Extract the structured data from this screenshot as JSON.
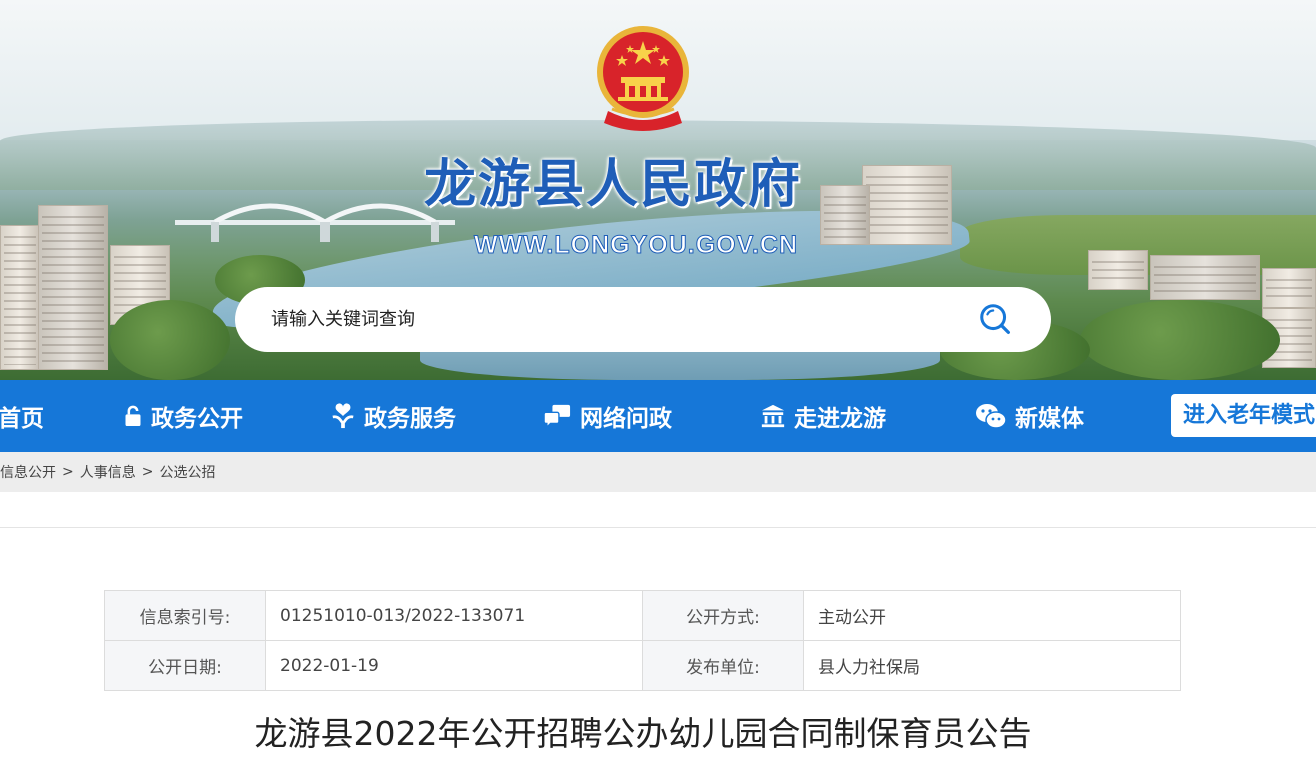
{
  "header": {
    "site_title": "龙游县人民政府",
    "site_url": "WWW.LONGYOU.GOV.CN",
    "emblem_icon": "national-emblem-icon",
    "search": {
      "placeholder": "请输入关键词查询",
      "icon": "search-icon"
    }
  },
  "nav": {
    "items": [
      {
        "label": "首页",
        "icon": ""
      },
      {
        "label": "政务公开",
        "icon": "lock-icon"
      },
      {
        "label": "政务服务",
        "icon": "heart-hand-icon"
      },
      {
        "label": "网络问政",
        "icon": "chat-icon"
      },
      {
        "label": "走进龙游",
        "icon": "building-icon"
      },
      {
        "label": "新媒体",
        "icon": "wechat-icon"
      }
    ],
    "elder_mode": "进入老年模式"
  },
  "breadcrumb": {
    "items": [
      "信息公开",
      "人事信息",
      "公选公招"
    ],
    "separator": ">"
  },
  "info": {
    "index_label": "信息索引号:",
    "index_value": "01251010-013/2022-133071",
    "open_method_label": "公开方式:",
    "open_method_value": "主动公开",
    "date_label": "公开日期:",
    "date_value": "2022-01-19",
    "publisher_label": "发布单位:",
    "publisher_value": "县人力社保局"
  },
  "article": {
    "title": "龙游县2022年公开招聘公办幼儿园合同制保育员公告"
  },
  "colors": {
    "nav_bg": "#1677d8",
    "title_blue": "#1f5eb8",
    "crumb_bg": "#ededed"
  }
}
